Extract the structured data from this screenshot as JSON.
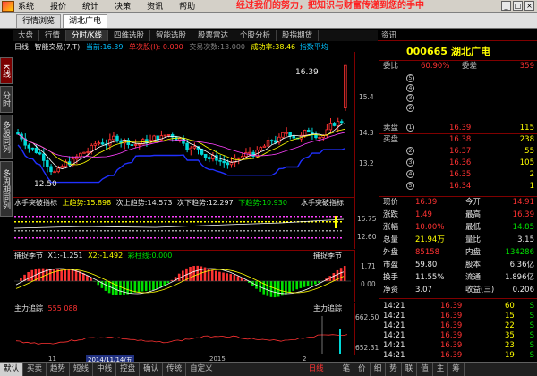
{
  "menu": [
    "系统",
    "报价",
    "统计",
    "决策",
    "资讯",
    "帮助"
  ],
  "slogan": "经过我们的努力，把知识与财富传递到您的手中",
  "window_buttons": [
    "_",
    "□",
    "×"
  ],
  "doc_tabs": [
    "行情浏览",
    "湖北广电"
  ],
  "side_tabs": [
    "K线",
    "分时",
    "多股同列",
    "多周期同列"
  ],
  "chart_tabs": [
    "大盘",
    "行情",
    "分时/K线",
    "四维选股",
    "智能选股",
    "股票雷达",
    "个股分析",
    "股指期货"
  ],
  "quote_tab": "资讯",
  "main_info": {
    "label": "日线",
    "indicator": "智能交易(7,T)",
    "ind_value": "当前:16.39",
    "buy": "单次股(I): 0.000",
    "vol": "交易次数:13.000",
    "rate": "成功率:38.46",
    "profit": "指数平均"
  },
  "high_label": "16.39",
  "low_label": "12.50",
  "price_axis": [
    "15.4",
    "14.3",
    "13.2"
  ],
  "ind1": {
    "title": "水手突破指标",
    "up": "上趋势:15.898",
    "up2": "次上趋势:14.573",
    "down2": "次下趋势:12.297",
    "down": "下趋势:10.930",
    "right": "水手突破指标",
    "axis": [
      "15.75",
      "12.60"
    ]
  },
  "ind2": {
    "title": "捕捉季节",
    "x1": "X1:-1.251",
    "x2": "X2:-1.492",
    "x3": "彩柱线:0.000",
    "right": "捕捉季节",
    "axis": [
      "1.71",
      "0.00"
    ]
  },
  "ind3": {
    "title": "主力追踪",
    "vals": "555 088",
    "right": "主力追踪",
    "axis": [
      "662.50",
      "652.31"
    ]
  },
  "x_axis": [
    "11",
    "2014/11/14/五",
    "2015",
    "2"
  ],
  "quote": {
    "code": "000665",
    "name": "湖北广电",
    "weibi_label": "委比",
    "weibi": "60.90%",
    "weicha_label": "委差",
    "weicha": "359",
    "sell_label": "卖盘",
    "buy_label": "买盘",
    "sell": [
      {
        "n": "5",
        "price": "",
        "vol": ""
      },
      {
        "n": "4",
        "price": "",
        "vol": ""
      },
      {
        "n": "3",
        "price": "",
        "vol": ""
      },
      {
        "n": "2",
        "price": "",
        "vol": ""
      },
      {
        "n": "1",
        "price": "16.39",
        "vol": "115"
      }
    ],
    "buy": [
      {
        "n": "1",
        "price": "16.38",
        "vol": "238"
      },
      {
        "n": "2",
        "price": "16.37",
        "vol": "55"
      },
      {
        "n": "3",
        "price": "16.36",
        "vol": "105"
      },
      {
        "n": "4",
        "price": "16.35",
        "vol": "2"
      },
      {
        "n": "5",
        "price": "16.34",
        "vol": "1"
      }
    ],
    "stats": [
      [
        "现价",
        "16.39",
        "今开",
        "14.91"
      ],
      [
        "涨跌",
        "1.49",
        "最高",
        "16.39"
      ],
      [
        "涨幅",
        "10.00%",
        "最低",
        "14.85"
      ],
      [
        "总量",
        "21.94万",
        "量比",
        "3.15"
      ],
      [
        "外盘",
        "85158",
        "内盘",
        "134286"
      ],
      [
        "市盈",
        "59.80",
        "股本",
        "6.36亿"
      ],
      [
        "换手",
        "11.55%",
        "流通",
        "1.896亿"
      ],
      [
        "净资",
        "3.07",
        "收益(三)",
        "0.206"
      ]
    ],
    "ticks": [
      [
        "14:21",
        "16.39",
        "60",
        "S"
      ],
      [
        "14:21",
        "16.39",
        "15",
        "S"
      ],
      [
        "14:21",
        "16.39",
        "22",
        "S"
      ],
      [
        "14:21",
        "16.39",
        "35",
        "S"
      ],
      [
        "14:21",
        "16.39",
        "23",
        "S"
      ],
      [
        "14:21",
        "16.39",
        "19",
        "S"
      ]
    ]
  },
  "bottom_tabs": [
    "默认",
    "买卖",
    "趋势",
    "短线",
    "中线",
    "控盘",
    "确认",
    "传统",
    "自定义"
  ],
  "bottom_right": "日线",
  "quote_bottom_tabs": [
    "笔",
    "价",
    "细",
    "势",
    "联",
    "值",
    "主",
    "筹"
  ],
  "colors": {
    "red": "#ff3232",
    "green": "#00e000",
    "yellow": "#ffff00",
    "blue": "#2030ff",
    "white": "#e8e8e8"
  }
}
